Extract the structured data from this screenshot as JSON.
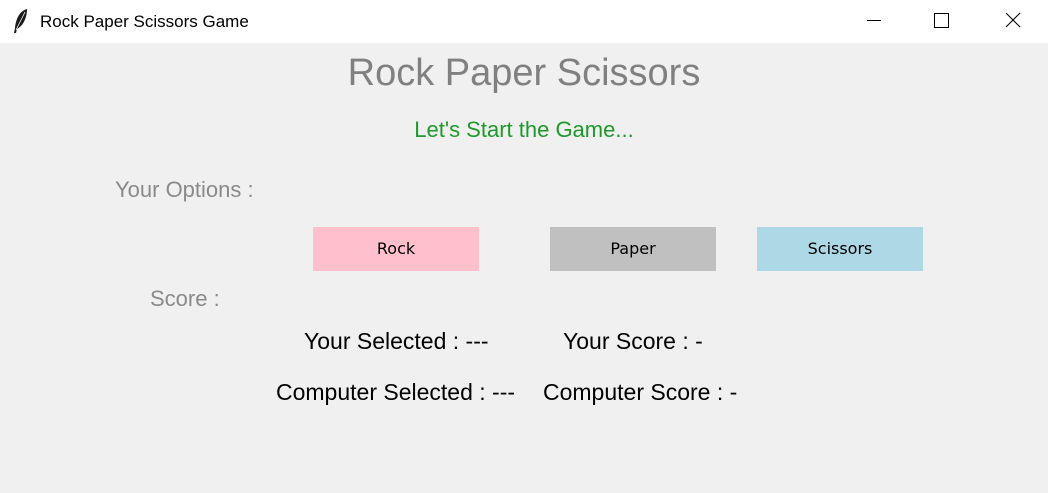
{
  "window": {
    "title": "Rock Paper Scissors Game",
    "icon": "feather-icon",
    "controls": {
      "minimize": "minimize-icon",
      "maximize": "maximize-icon",
      "close": "close-icon"
    }
  },
  "game": {
    "heading": "Rock Paper Scissors",
    "status": "Let's Start the Game...",
    "options_label": "Your Options :",
    "score_label": "Score :",
    "buttons": {
      "rock": "Rock",
      "paper": "Paper",
      "scissors": "Scissors"
    },
    "results": {
      "your_selected": "Your Selected : ---",
      "your_score": "Your Score : -",
      "computer_selected": "Computer Selected : ---",
      "computer_score": "Computer Score : -"
    }
  },
  "colors": {
    "background": "#f0f0f0",
    "heading": "#808080",
    "status": "#1e9a2a",
    "label": "#8a8a8a",
    "rock_button": "#ffc0cb",
    "paper_button": "#c0c0c0",
    "scissors_button": "#add8e6"
  }
}
